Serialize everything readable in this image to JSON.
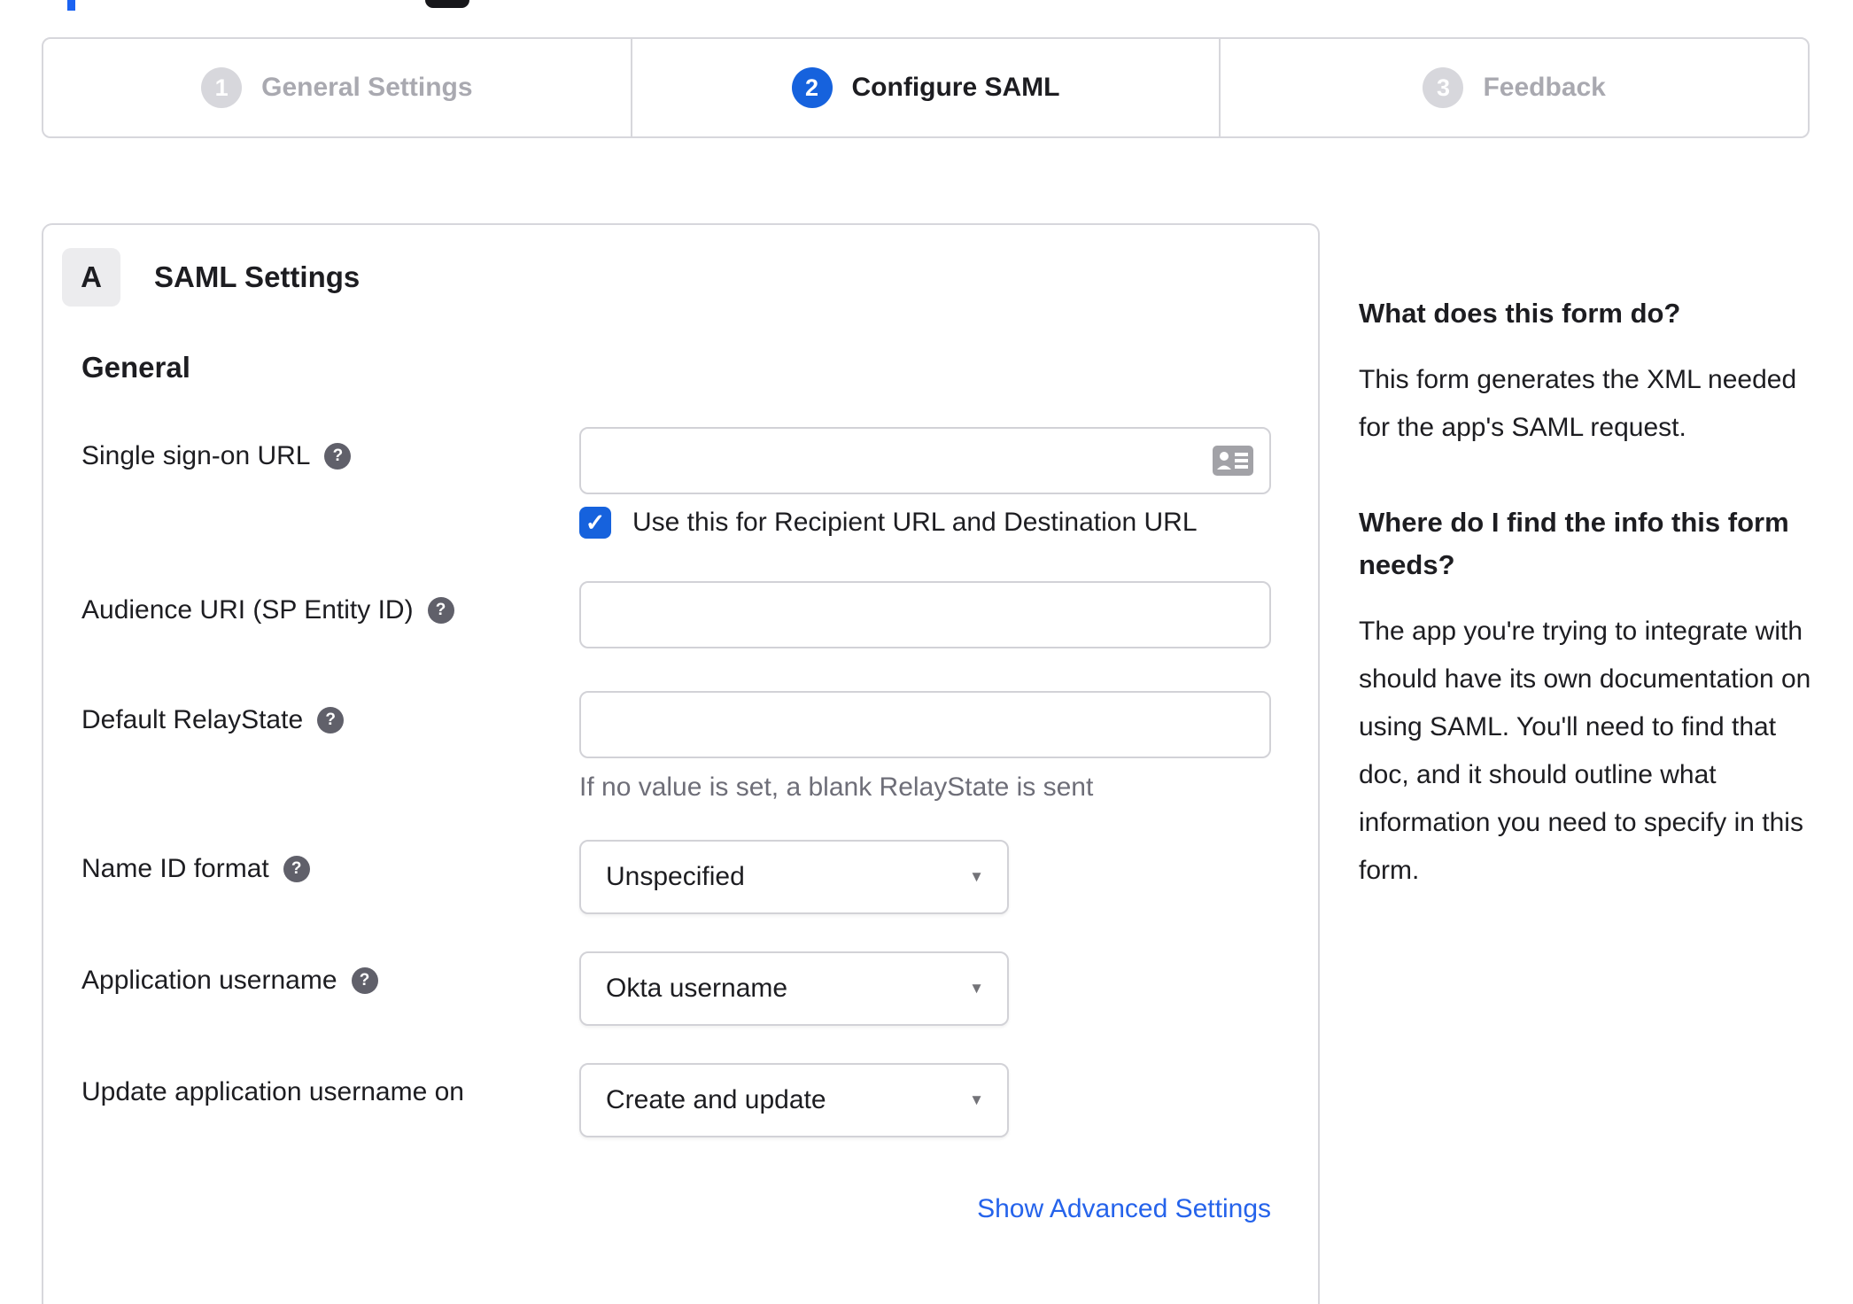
{
  "stepper": {
    "steps": [
      {
        "number": "1",
        "label": "General Settings",
        "state": "inactive"
      },
      {
        "number": "2",
        "label": "Configure SAML",
        "state": "active"
      },
      {
        "number": "3",
        "label": "Feedback",
        "state": "inactive"
      }
    ]
  },
  "panel": {
    "badge": "A",
    "title": "SAML Settings",
    "section_title": "General"
  },
  "form": {
    "sso_url": {
      "label": "Single sign-on URL",
      "value": "",
      "checkbox_label": "Use this for Recipient URL and Destination URL",
      "checkbox_checked": true
    },
    "audience_uri": {
      "label": "Audience URI (SP Entity ID)",
      "value": ""
    },
    "relay_state": {
      "label": "Default RelayState",
      "value": "",
      "hint": "If no value is set, a blank RelayState is sent"
    },
    "name_id_format": {
      "label": "Name ID format",
      "value": "Unspecified"
    },
    "app_username": {
      "label": "Application username",
      "value": "Okta username"
    },
    "update_app_username": {
      "label": "Update application username on",
      "value": "Create and update"
    },
    "advanced_link": "Show Advanced Settings"
  },
  "sidebar": {
    "heading1": "What does this form do?",
    "para1": "This form generates the XML needed\nfor the app's SAML request.",
    "heading2": "Where do I find the info this form\nneeds?",
    "para2": "The app you're trying to integrate with\nshould have its own documentation on\nusing SAML. You'll need to find that\ndoc, and it should outline what\ninformation you need to specify in this\nform."
  },
  "icons": {
    "help": "?",
    "check": "✓",
    "select_arrow": "▼"
  },
  "colors": {
    "accent_blue": "#1662dd",
    "link_blue": "#2563eb",
    "border_gray": "#d7d7dc",
    "inactive_gray": "#a9a9b0",
    "text_dark": "#1d1d21",
    "hint_gray": "#6e6e78"
  }
}
